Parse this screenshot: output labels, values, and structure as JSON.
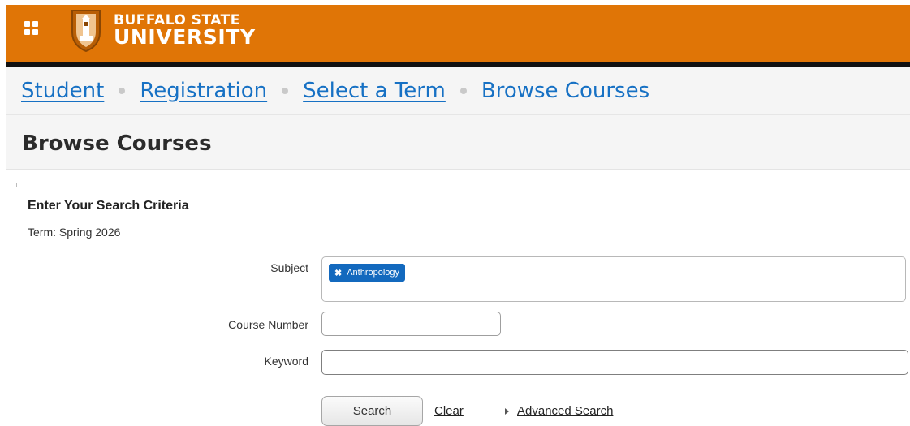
{
  "header": {
    "app_menu_icon": "apps-grid-icon",
    "logo_icon": "university-crest-icon",
    "logo_line1": "BUFFALO STATE",
    "logo_line2": "UNIVERSITY",
    "brand_color": "#e07506"
  },
  "breadcrumb": {
    "items": [
      {
        "label": "Student"
      },
      {
        "label": "Registration"
      },
      {
        "label": "Select a Term"
      }
    ],
    "current": "Browse Courses"
  },
  "page_title": "Browse Courses",
  "form": {
    "heading": "Enter Your Search Criteria",
    "term_text": "Term: Spring 2026",
    "subject": {
      "label": "Subject",
      "selected_tags": [
        {
          "label": "Anthropology",
          "remove_icon": "close-icon"
        }
      ]
    },
    "course_number": {
      "label": "Course Number",
      "value": ""
    },
    "keyword": {
      "label": "Keyword",
      "value": ""
    },
    "search_button": "Search",
    "clear_link": "Clear",
    "advanced_search_link": "Advanced Search",
    "advanced_search_icon": "caret-right-icon"
  },
  "colors": {
    "link": "#1771c4",
    "tag_bg": "#1369be"
  }
}
